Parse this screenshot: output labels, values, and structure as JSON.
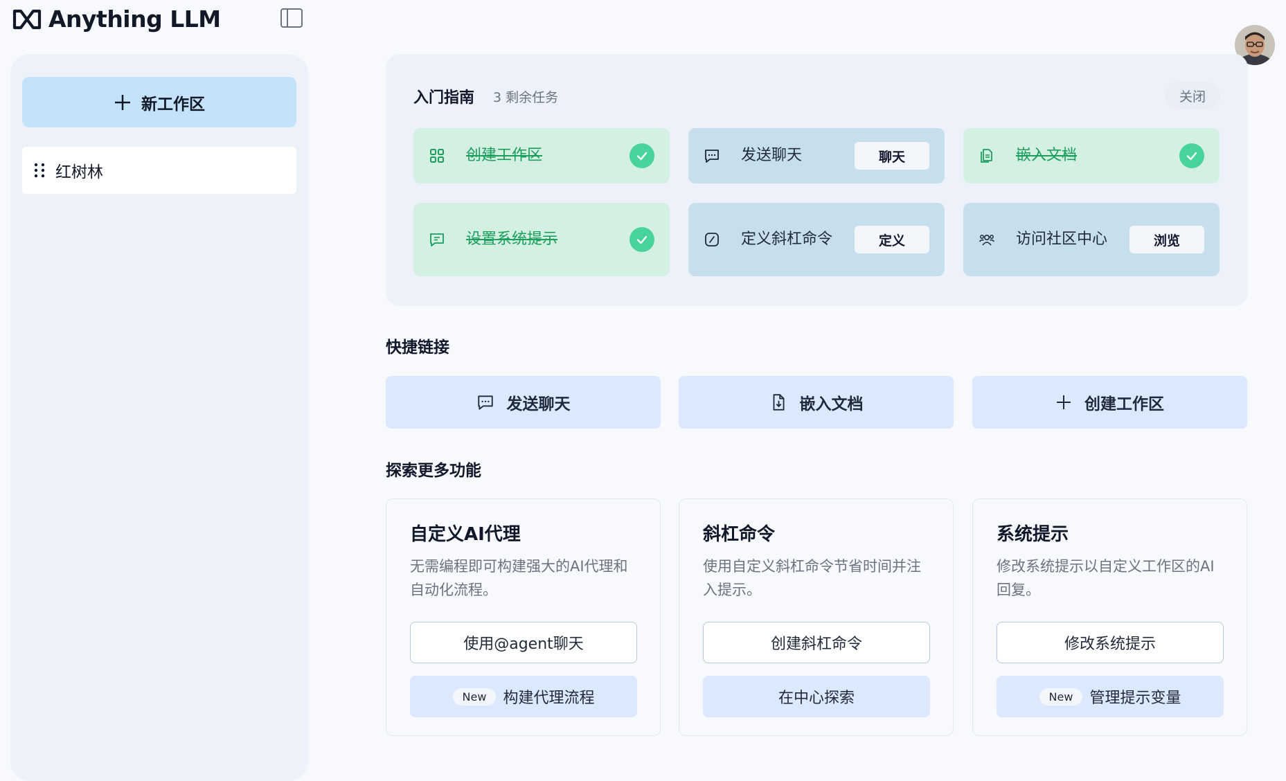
{
  "app": {
    "logo_text": "Anything LLM"
  },
  "sidebar": {
    "new_workspace_label": "新工作区",
    "workspaces": [
      {
        "label": "红树林"
      }
    ]
  },
  "getting_started": {
    "title": "入门指南",
    "remaining": "3 剩余任务",
    "close_label": "关闭",
    "tasks": [
      {
        "label": "创建工作区",
        "status": "done",
        "icon": "grid-icon"
      },
      {
        "label": "发送聊天",
        "status": "todo",
        "action": "聊天",
        "icon": "chat-bubble-icon"
      },
      {
        "label": "嵌入文档",
        "status": "done",
        "icon": "document-icon"
      },
      {
        "label": "设置系统提示",
        "status": "done",
        "icon": "message-square-icon"
      },
      {
        "label": "定义斜杠命令",
        "status": "todo",
        "action": "定义",
        "icon": "slash-icon"
      },
      {
        "label": "访问社区中心",
        "status": "todo",
        "action": "浏览",
        "icon": "users-icon"
      }
    ]
  },
  "quick_links": {
    "title": "快捷链接",
    "items": [
      {
        "label": "发送聊天",
        "icon": "chat-bubble-icon"
      },
      {
        "label": "嵌入文档",
        "icon": "file-download-icon"
      },
      {
        "label": "创建工作区",
        "icon": "plus-icon"
      }
    ]
  },
  "explore": {
    "title": "探索更多功能",
    "cards": [
      {
        "title": "自定义AI代理",
        "description": "无需编程即可构建强大的AI代理和自动化流程。",
        "primary_label": "使用@agent聊天",
        "secondary_label": "构建代理流程",
        "secondary_badge": "New"
      },
      {
        "title": "斜杠命令",
        "description": "使用自定义斜杠命令节省时间并注入提示。",
        "primary_label": "创建斜杠命令",
        "secondary_label": "在中心探索",
        "secondary_badge": ""
      },
      {
        "title": "系统提示",
        "description": "修改系统提示以自定义工作区的AI回复。",
        "primary_label": "修改系统提示",
        "secondary_label": "管理提示变量",
        "secondary_badge": "New"
      }
    ]
  },
  "colors": {
    "accent": "#c4e3fb",
    "done_bg": "#d4f0e3",
    "done_text": "#1a9e5c",
    "todo_bg": "#c7dfec",
    "check": "#48d39a",
    "quick_link_bg": "#dbe8fd"
  }
}
